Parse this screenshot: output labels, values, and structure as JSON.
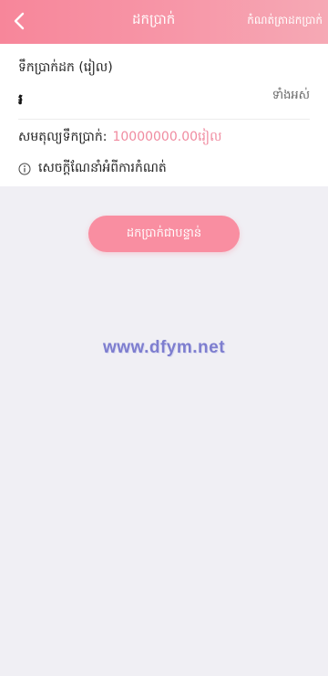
{
  "header": {
    "back_icon": "chevron-left-icon",
    "title": "ដកប្រាក់",
    "link_label": "កំណត់ត្រាដកប្រាក់"
  },
  "form": {
    "amount_label": "ទឹកប្រាក់ដក (រៀល)",
    "currency_symbol": "៛",
    "amount_value": "",
    "all_label": "ទាំងអស់",
    "balance_label": "សមតុល្យទឹកប្រាក់:",
    "balance_value": "10000000.00រៀល",
    "guide_icon": "info-icon",
    "guide_label": "សេចក្តីណែនាំអំពីការកំណត់"
  },
  "submit_label": "ដកប្រាក់ជាបន្ទាន់",
  "watermark": "www.dfym.net",
  "colors": {
    "accent": "#f98ea1",
    "balance": "#f08ba0",
    "background": "#f0eff4"
  }
}
